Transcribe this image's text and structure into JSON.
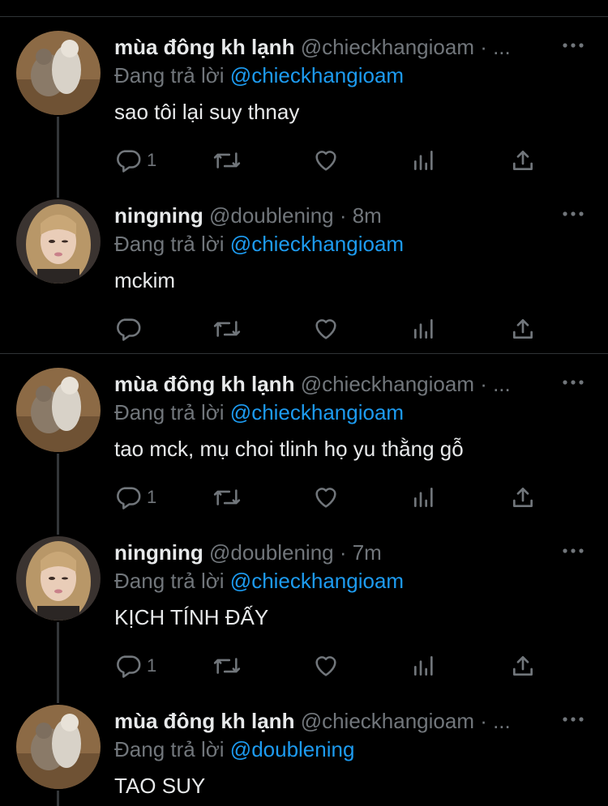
{
  "tweets": [
    {
      "name": "mùa đông kh lạnh",
      "handle_meta": "@chieckhangioam · ...",
      "reply_prefix": "Đang trả lời",
      "reply_to": "@chieckhangioam",
      "text": "sao tôi lại suy thnay",
      "reply_count": "1",
      "avatar": "cat-avatar"
    },
    {
      "name": "ningning",
      "handle_meta": "@doublening · 8m",
      "reply_prefix": "Đang trả lời",
      "reply_to": "@chieckhangioam",
      "text": "mckim",
      "reply_count": "",
      "avatar": "girl-avatar"
    },
    {
      "name": "mùa đông kh lạnh",
      "handle_meta": "@chieckhangioam · ...",
      "reply_prefix": "Đang trả lời",
      "reply_to": "@chieckhangioam",
      "text": "tao mck, mụ choi tlinh họ yu thằng gỗ",
      "reply_count": "1",
      "avatar": "cat-avatar"
    },
    {
      "name": "ningning",
      "handle_meta": "@doublening · 7m",
      "reply_prefix": "Đang trả lời",
      "reply_to": "@chieckhangioam",
      "text": "KỊCH TÍNH ĐẤY",
      "reply_count": "1",
      "avatar": "girl-avatar"
    },
    {
      "name": "mùa đông kh lạnh",
      "handle_meta": "@chieckhangioam · ...",
      "reply_prefix": "Đang trả lời",
      "reply_to": "@doublening",
      "text": "TAO SUY",
      "reply_count": "",
      "avatar": "cat-avatar"
    }
  ],
  "colors": {
    "background": "#000000",
    "text": "#e7e9ea",
    "secondary": "#71767b",
    "mention": "#1d9bf0",
    "divider": "#2f3336"
  }
}
